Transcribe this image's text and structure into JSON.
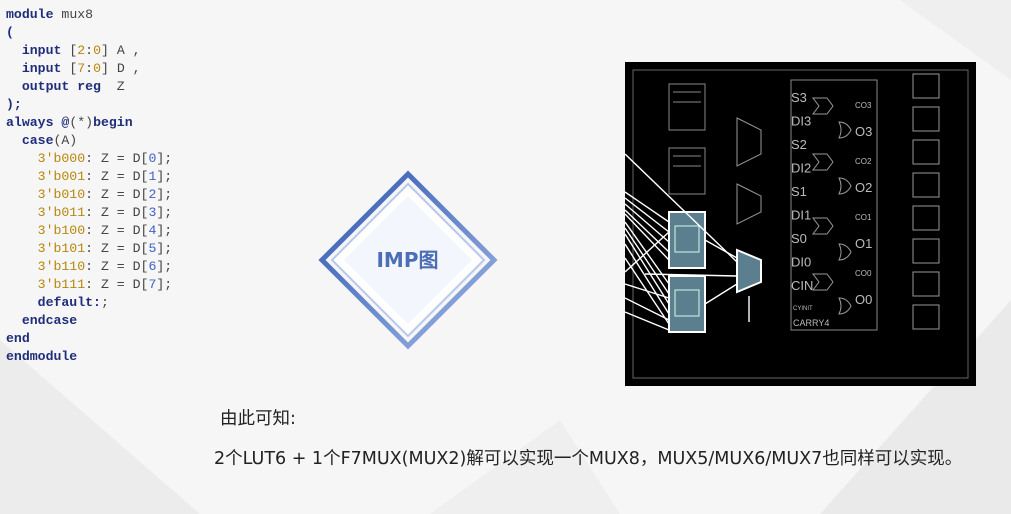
{
  "code": {
    "lines": [
      [
        {
          "t": "module ",
          "c": "kw"
        },
        {
          "t": "mux8",
          "c": "plain"
        }
      ],
      [
        {
          "t": "(",
          "c": "kw"
        }
      ],
      [
        {
          "t": "  input ",
          "c": "kw"
        },
        {
          "t": "[",
          "c": "plain"
        },
        {
          "t": "2",
          "c": "num"
        },
        {
          "t": ":",
          "c": "plain"
        },
        {
          "t": "0",
          "c": "num"
        },
        {
          "t": "] A ,",
          "c": "plain"
        }
      ],
      [
        {
          "t": "  input ",
          "c": "kw"
        },
        {
          "t": "[",
          "c": "plain"
        },
        {
          "t": "7",
          "c": "num"
        },
        {
          "t": ":",
          "c": "plain"
        },
        {
          "t": "0",
          "c": "num"
        },
        {
          "t": "] D ,",
          "c": "plain"
        }
      ],
      [
        {
          "t": "  output reg ",
          "c": "kw"
        },
        {
          "t": " Z",
          "c": "plain"
        }
      ],
      [
        {
          "t": ");",
          "c": "kw"
        }
      ],
      [
        {
          "t": "always @",
          "c": "kw"
        },
        {
          "t": "(*)",
          "c": "plain"
        },
        {
          "t": "begin",
          "c": "kw"
        }
      ],
      [
        {
          "t": "  case",
          "c": "kw"
        },
        {
          "t": "(A)",
          "c": "plain"
        }
      ],
      [
        {
          "t": "    3'b000",
          "c": "num"
        },
        {
          "t": ": Z = D[",
          "c": "plain"
        },
        {
          "t": "0",
          "c": "bit"
        },
        {
          "t": "];",
          "c": "plain"
        }
      ],
      [
        {
          "t": "    3'b001",
          "c": "num"
        },
        {
          "t": ": Z = D[",
          "c": "plain"
        },
        {
          "t": "1",
          "c": "bit"
        },
        {
          "t": "];",
          "c": "plain"
        }
      ],
      [
        {
          "t": "    3'b010",
          "c": "num"
        },
        {
          "t": ": Z = D[",
          "c": "plain"
        },
        {
          "t": "2",
          "c": "bit"
        },
        {
          "t": "];",
          "c": "plain"
        }
      ],
      [
        {
          "t": "    3'b011",
          "c": "num"
        },
        {
          "t": ": Z = D[",
          "c": "plain"
        },
        {
          "t": "3",
          "c": "bit"
        },
        {
          "t": "];",
          "c": "plain"
        }
      ],
      [
        {
          "t": "    3'b100",
          "c": "num"
        },
        {
          "t": ": Z = D[",
          "c": "plain"
        },
        {
          "t": "4",
          "c": "bit"
        },
        {
          "t": "];",
          "c": "plain"
        }
      ],
      [
        {
          "t": "    3'b101",
          "c": "num"
        },
        {
          "t": ": Z = D[",
          "c": "plain"
        },
        {
          "t": "5",
          "c": "bit"
        },
        {
          "t": "];",
          "c": "plain"
        }
      ],
      [
        {
          "t": "    3'b110",
          "c": "num"
        },
        {
          "t": ": Z = D[",
          "c": "plain"
        },
        {
          "t": "6",
          "c": "bit"
        },
        {
          "t": "];",
          "c": "plain"
        }
      ],
      [
        {
          "t": "    3'b111",
          "c": "num"
        },
        {
          "t": ": Z = D[",
          "c": "plain"
        },
        {
          "t": "7",
          "c": "bit"
        },
        {
          "t": "];",
          "c": "plain"
        }
      ],
      [
        {
          "t": "    default:",
          "c": "kw"
        },
        {
          "t": ";",
          "c": "plain"
        }
      ],
      [
        {
          "t": "  endcase",
          "c": "kw"
        }
      ],
      [
        {
          "t": "end",
          "c": "kw"
        }
      ],
      [
        {
          "t": "endmodule",
          "c": "kw"
        }
      ]
    ]
  },
  "imp_label": "IMP图",
  "schematic": {
    "carry_labels": [
      "S3",
      "DI3",
      "S2",
      "DI2",
      "S1",
      "DI1",
      "S0",
      "DI0",
      "CIN"
    ],
    "co_labels": [
      "CO3",
      "CO2",
      "CO1",
      "CO0"
    ],
    "o_labels": [
      "O3",
      "O2",
      "O1",
      "O0"
    ],
    "cyinit": "CYINIT",
    "carry_name": "CARRY4"
  },
  "conclusion_title": "由此可知:",
  "conclusion_body": "2个LUT6 + 1个F7MUX(MUX2)解可以实现一个MUX8，MUX5/MUX6/MUX7也同样可以实现。"
}
